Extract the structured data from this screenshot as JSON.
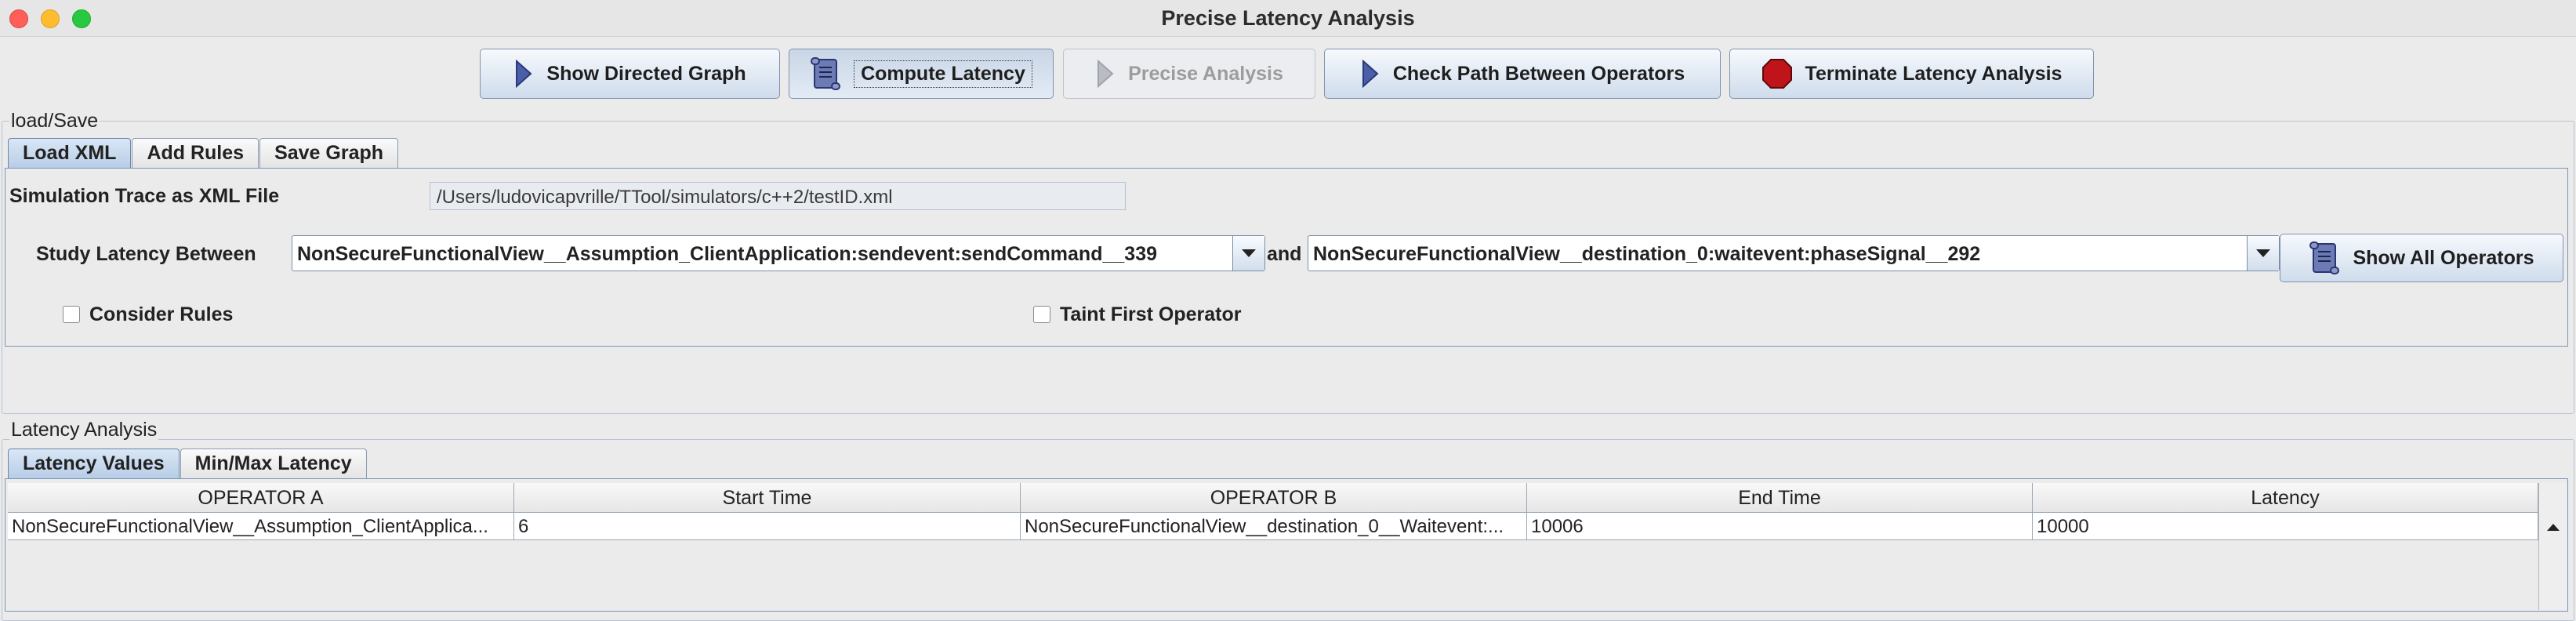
{
  "window": {
    "title": "Precise Latency Analysis"
  },
  "toolbar": {
    "show_graph": "Show Directed Graph",
    "compute_latency": "Compute Latency",
    "precise_analysis": "Precise Analysis",
    "check_path": "Check Path Between Operators",
    "terminate": "Terminate Latency Analysis"
  },
  "load_save": {
    "group_label": "load/Save",
    "tabs": [
      "Load XML",
      "Add Rules",
      "Save Graph"
    ],
    "trace_label": "Simulation Trace as XML File",
    "trace_path": "/Users/ludovicapvrille/TTool/simulators/c++2/testID.xml",
    "study_label": "Study Latency Between",
    "operator_a": "NonSecureFunctionalView__Assumption_ClientApplication:sendevent:sendCommand__339",
    "and_label": "and",
    "operator_b": "NonSecureFunctionalView__destination_0:waitevent:phaseSignal__292",
    "show_all_operators": "Show All Operators",
    "consider_rules": "Consider Rules",
    "taint_first_operator": "Taint First Operator"
  },
  "latency": {
    "group_label": "Latency Analysis",
    "tabs": [
      "Latency Values",
      "Min/Max Latency"
    ],
    "columns": [
      "OPERATOR A",
      "Start Time",
      "OPERATOR B",
      "End Time",
      "Latency"
    ],
    "rows": [
      [
        "NonSecureFunctionalView__Assumption_ClientApplica...",
        "6",
        "NonSecureFunctionalView__destination_0__Waitevent:...",
        "10006",
        "10000"
      ]
    ]
  },
  "icons": {
    "play": "play-triangle-icon",
    "scroll": "scroll-icon",
    "stop": "stop-octagon-icon"
  },
  "colors": {
    "close": "#fe5f57",
    "minimize": "#febc2e",
    "maximize": "#28c840",
    "stop_red": "#c0141b",
    "play_blue": "#4a5fa8"
  }
}
